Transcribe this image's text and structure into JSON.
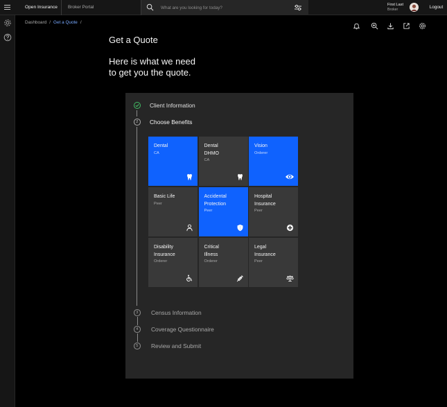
{
  "header": {
    "app_name": "Open Insurance",
    "portal_label": "Broker Portal",
    "search_placeholder": "What are you looking for today?",
    "user": {
      "name": "First Last",
      "role": "Broker"
    },
    "logout_label": "Logout"
  },
  "breadcrumb": {
    "root": "Dashboard",
    "current": "Get a Quote",
    "separator": "/"
  },
  "page": {
    "title": "Get a Quote",
    "subtitle": "Here is what we need\nto get you the quote."
  },
  "steps": [
    {
      "label": "Client Information",
      "number": "1",
      "state": "complete"
    },
    {
      "label": "Choose Benefits",
      "number": "2",
      "state": "current"
    },
    {
      "label": "Census Information",
      "number": "3",
      "state": "upcoming"
    },
    {
      "label": "Coverage Questionnaire",
      "number": "4",
      "state": "upcoming"
    },
    {
      "label": "Review and Submit",
      "number": "5",
      "state": "upcoming"
    }
  ],
  "benefits": [
    {
      "title": "Dental",
      "subtitle": "CA",
      "icon": "tooth-icon",
      "selected": true
    },
    {
      "title": "Dental\nDHMO",
      "subtitle": "CA",
      "icon": "tooth-icon",
      "selected": false
    },
    {
      "title": "Vision",
      "subtitle": "Orderer",
      "icon": "eye-icon",
      "selected": true
    },
    {
      "title": "Basic Life",
      "subtitle": "Peer",
      "icon": "person-icon",
      "selected": false
    },
    {
      "title": "Accidental\nProtection",
      "subtitle": "Peer",
      "icon": "shield-icon",
      "selected": true
    },
    {
      "title": "Hospital\nInsurance",
      "subtitle": "Peer",
      "icon": "medical-plus-icon",
      "selected": false
    },
    {
      "title": "Disability\nInsurance",
      "subtitle": "Orderer",
      "icon": "wheelchair-icon",
      "selected": false
    },
    {
      "title": "Critical\nIllness",
      "subtitle": "Orderer",
      "icon": "syringe-icon",
      "selected": false
    },
    {
      "title": "Legal\nInsurance",
      "subtitle": "Peer",
      "icon": "scales-icon",
      "selected": false
    }
  ],
  "toolbar_icons": [
    "bell-icon",
    "zoom-in-icon",
    "download-icon",
    "launch-icon",
    "settings-icon"
  ],
  "rail_icons": [
    "settings-icon",
    "help-icon"
  ],
  "colors": {
    "accent": "#0f62fe",
    "success": "#42be65",
    "background": "#000000",
    "panel": "#262626",
    "tile": "#393939"
  }
}
